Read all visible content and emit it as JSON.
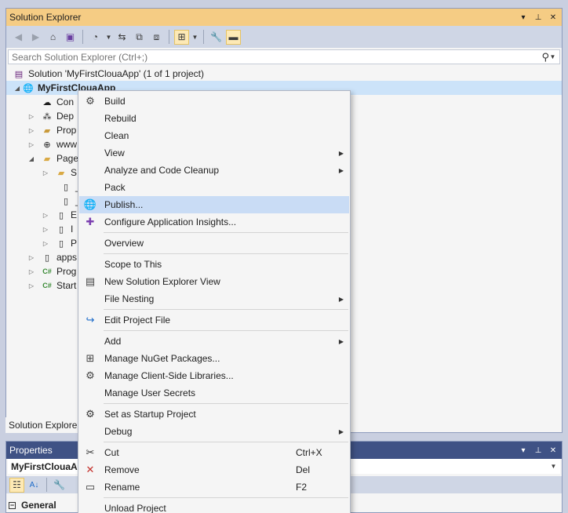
{
  "solution_explorer": {
    "title": "Solution Explorer",
    "search_placeholder": "Search Solution Explorer (Ctrl+;)",
    "bottom_tab": "Solution Explorer",
    "tree": [
      {
        "label": "Solution 'MyFirstClouaApp' (1 of 1 project)",
        "icon": "solution-icon",
        "bold": false
      },
      {
        "label": "MyFirstClouaApp",
        "icon": "web-project-icon",
        "bold": true
      },
      {
        "label": "Con",
        "icon": "connected-services-icon"
      },
      {
        "label": "Dep",
        "icon": "dependencies-icon"
      },
      {
        "label": "Prop",
        "icon": "properties-folder-icon"
      },
      {
        "label": "www",
        "icon": "globe-icon"
      },
      {
        "label": "Page",
        "icon": "folder-icon"
      },
      {
        "label": "S",
        "icon": "folder-icon"
      },
      {
        "label": "_",
        "icon": "file-icon"
      },
      {
        "label": "_",
        "icon": "file-icon"
      },
      {
        "label": "E",
        "icon": "file-icon"
      },
      {
        "label": "I",
        "icon": "file-icon"
      },
      {
        "label": "P",
        "icon": "file-icon"
      },
      {
        "label": "apps",
        "icon": "settings-file-icon"
      },
      {
        "label": "Prog",
        "icon": "csharp-icon"
      },
      {
        "label": "Start",
        "icon": "csharp-icon"
      }
    ]
  },
  "properties": {
    "title": "Properties",
    "object_name": "MyFirstClouaApp",
    "category": "General"
  },
  "context_menu": {
    "items": [
      {
        "type": "item",
        "label": "Build",
        "icon": "build-icon"
      },
      {
        "type": "item",
        "label": "Rebuild"
      },
      {
        "type": "item",
        "label": "Clean"
      },
      {
        "type": "item",
        "label": "View",
        "submenu": true
      },
      {
        "type": "item",
        "label": "Analyze and Code Cleanup",
        "submenu": true
      },
      {
        "type": "item",
        "label": "Pack"
      },
      {
        "type": "item",
        "label": "Publish...",
        "icon": "publish-icon",
        "highlighted": true
      },
      {
        "type": "item",
        "label": "Configure Application Insights...",
        "icon": "app-insights-icon"
      },
      {
        "type": "separator"
      },
      {
        "type": "item",
        "label": "Overview"
      },
      {
        "type": "separator"
      },
      {
        "type": "item",
        "label": "Scope to This"
      },
      {
        "type": "item",
        "label": "New Solution Explorer View",
        "icon": "new-view-icon"
      },
      {
        "type": "item",
        "label": "File Nesting",
        "submenu": true
      },
      {
        "type": "separator"
      },
      {
        "type": "item",
        "label": "Edit Project File",
        "icon": "edit-project-icon"
      },
      {
        "type": "separator"
      },
      {
        "type": "item",
        "label": "Add",
        "submenu": true
      },
      {
        "type": "item",
        "label": "Manage NuGet Packages...",
        "icon": "nuget-icon"
      },
      {
        "type": "item",
        "label": "Manage Client-Side Libraries...",
        "icon": "client-libraries-icon"
      },
      {
        "type": "item",
        "label": "Manage User Secrets"
      },
      {
        "type": "separator"
      },
      {
        "type": "item",
        "label": "Set as Startup Project",
        "icon": "gear-icon"
      },
      {
        "type": "item",
        "label": "Debug",
        "submenu": true
      },
      {
        "type": "separator"
      },
      {
        "type": "item",
        "label": "Cut",
        "icon": "scissors-icon",
        "shortcut": "Ctrl+X"
      },
      {
        "type": "item",
        "label": "Remove",
        "icon": "remove-x-icon",
        "shortcut": "Del"
      },
      {
        "type": "item",
        "label": "Rename",
        "icon": "rename-icon",
        "shortcut": "F2"
      },
      {
        "type": "separator"
      },
      {
        "type": "item",
        "label": "Unload Project"
      }
    ]
  }
}
